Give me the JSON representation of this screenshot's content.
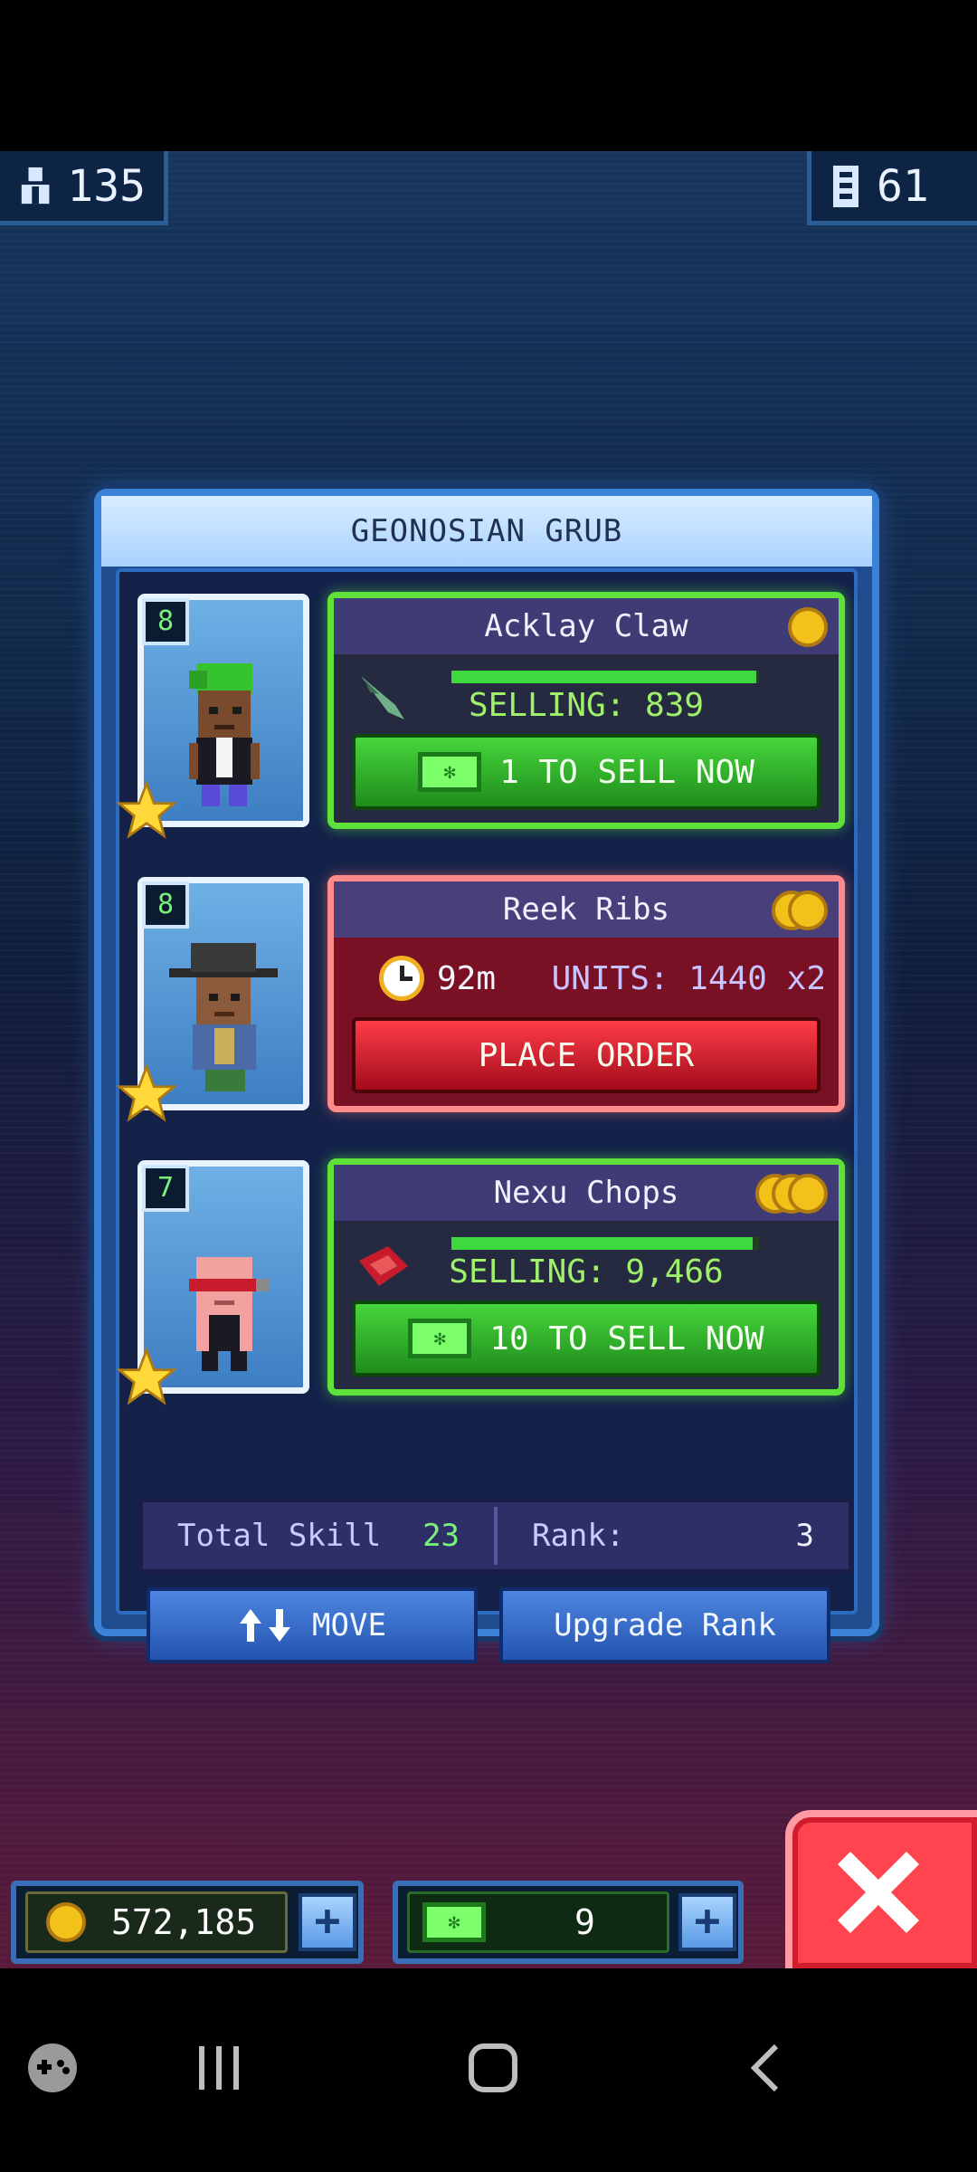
{
  "top_bar": {
    "population_count": "135",
    "floors_count": "61"
  },
  "panel": {
    "title": "GEONOSIAN GRUB",
    "rows": [
      {
        "level": "8",
        "item_name": "Acklay Claw",
        "status_text": "SELLING: 839",
        "progress": 0.99,
        "action_label": "1 TO SELL NOW",
        "state": "selling",
        "coin_tier": 1
      },
      {
        "level": "8",
        "item_name": "Reek Ribs",
        "timer": "92m",
        "units_text": "UNITS: 1440 x2",
        "action_label": "PLACE ORDER",
        "state": "order",
        "coin_tier": 2
      },
      {
        "level": "7",
        "item_name": "Nexu Chops",
        "status_text": "SELLING: 9,466",
        "progress": 0.98,
        "action_label": "10 TO SELL NOW",
        "state": "selling",
        "coin_tier": 3
      }
    ],
    "stats": {
      "total_skill_label": "Total Skill",
      "total_skill_value": "23",
      "rank_label": "Rank:",
      "rank_value": "3"
    },
    "move_label": "MOVE",
    "upgrade_label": "Upgrade Rank"
  },
  "currency": {
    "coins": "572,185",
    "bux": "9"
  },
  "colors": {
    "selling_border": "#5ee23a",
    "order_border": "#ff8a8a",
    "panel_border": "#3a82d8",
    "close_red": "#ff4450"
  }
}
